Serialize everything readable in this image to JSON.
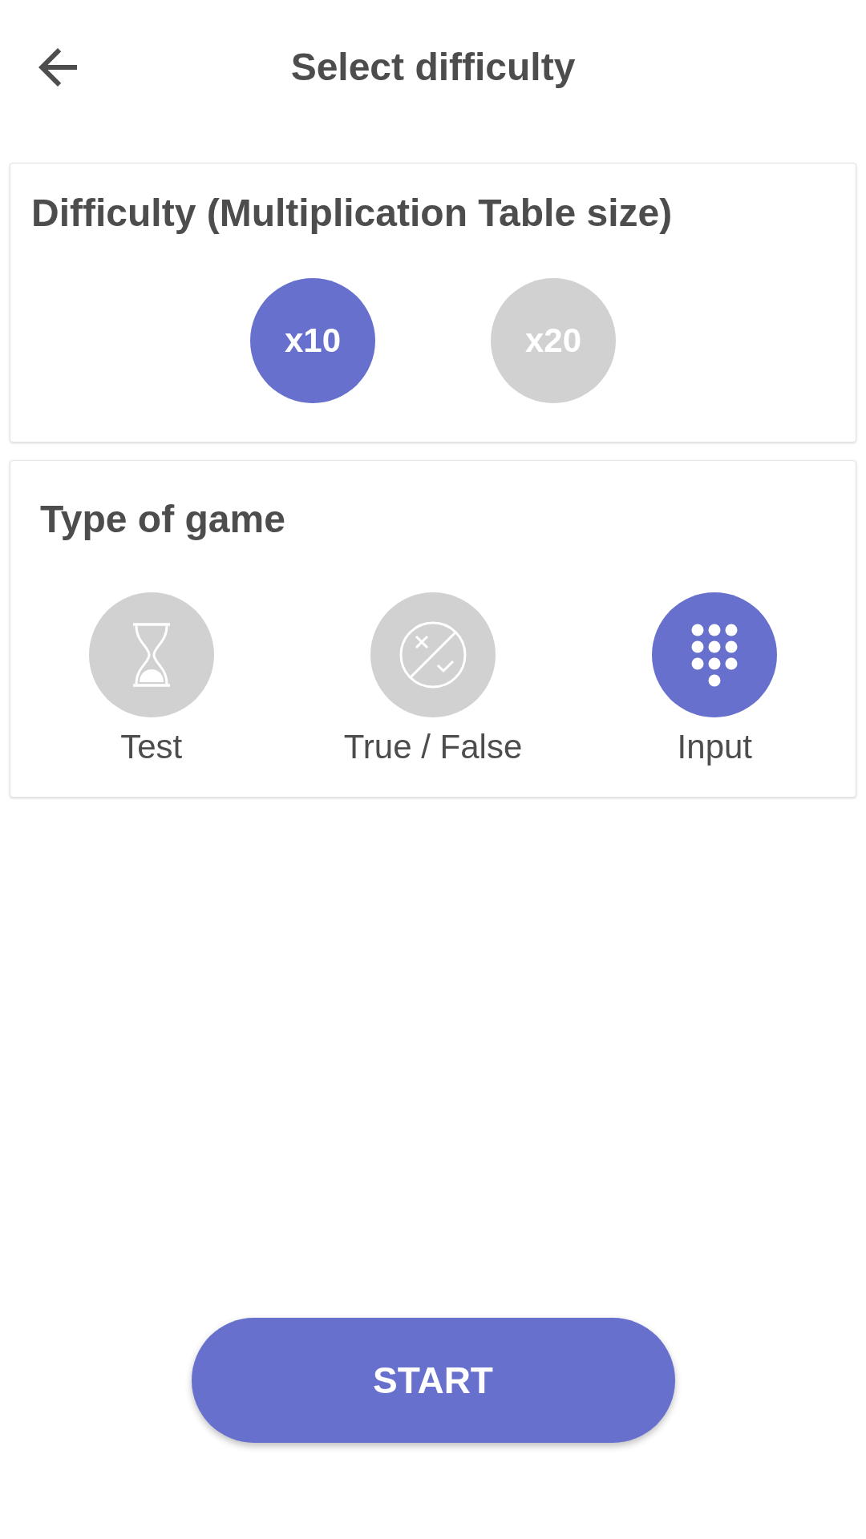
{
  "header": {
    "title": "Select difficulty"
  },
  "difficulty": {
    "title": "Difficulty (Multiplication Table size)",
    "options": [
      {
        "label": "x10",
        "selected": true
      },
      {
        "label": "x20",
        "selected": false
      }
    ]
  },
  "game_type": {
    "title": "Type of game",
    "options": [
      {
        "label": "Test",
        "kind": "hourglass",
        "selected": false
      },
      {
        "label": "True / False",
        "kind": "true-false",
        "selected": false
      },
      {
        "label": "Input",
        "kind": "keypad",
        "selected": true
      }
    ]
  },
  "start_button": {
    "label": "START"
  }
}
